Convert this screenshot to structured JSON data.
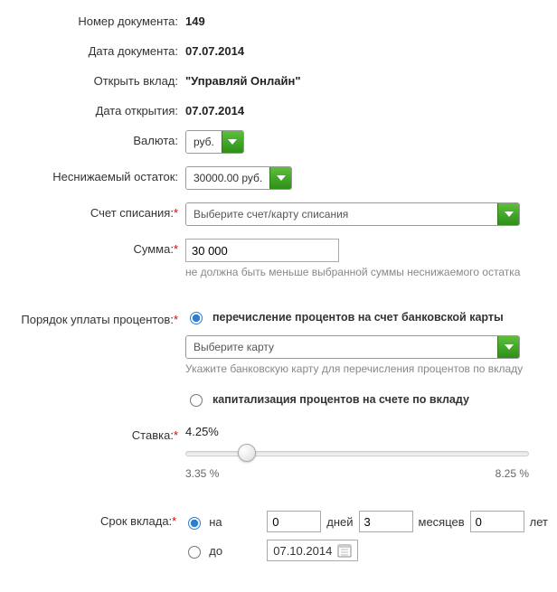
{
  "labels": {
    "doc_number": "Номер документа:",
    "doc_date": "Дата документа:",
    "open_deposit": "Открыть вклад:",
    "open_date": "Дата открытия:",
    "currency": "Валюта:",
    "min_balance": "Неснижаемый остаток:",
    "debit_account": "Счет списания:",
    "amount": "Сумма:",
    "interest_order": "Порядок уплаты процентов:",
    "rate": "Ставка:",
    "term": "Срок вклада:"
  },
  "values": {
    "doc_number": "149",
    "doc_date": "07.07.2014",
    "open_deposit": "\"Управляй Онлайн\"",
    "open_date": "07.07.2014",
    "currency": "руб.",
    "min_balance": "30000.00 руб.",
    "debit_account_placeholder": "Выберите счет/карту списания",
    "amount": "30 000",
    "amount_hint": "не должна быть меньше выбранной суммы неснижаемого остатка",
    "interest_option_card": "перечисление процентов на счет банковской карты",
    "interest_card_placeholder": "Выберите карту",
    "interest_card_hint": "Укажите банковскую карту для перечисления процентов по вкладу",
    "interest_option_capitalize": "капитализация процентов на счете по вкладу",
    "rate": "4.25%",
    "rate_min": "3.35 %",
    "rate_max": "8.25 %",
    "term_option_duration": "на",
    "term_option_until": "до",
    "days": "0",
    "days_label": "дней",
    "months": "3",
    "months_label": "месяцев",
    "years": "0",
    "years_label": "лет",
    "until_date": "07.10.2014"
  },
  "slider": {
    "percent": 18
  }
}
